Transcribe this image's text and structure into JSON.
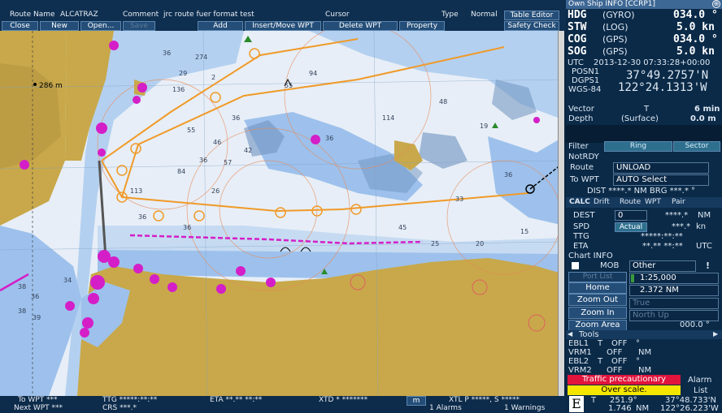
{
  "topbar": {
    "route_name_label": "Route Name",
    "route_name_value": "ALCATRAZ",
    "comment_label": "Comment",
    "comment_value": "jrc route fuer format test",
    "cursor_label": "Cursor",
    "type_label": "Type",
    "type_value": "Normal",
    "table_editor_label": "Table Editor",
    "close_label": "Close",
    "new_label": "New",
    "open_label": "Open...",
    "save_label": "Save",
    "add_label": "Add",
    "insert_move_label": "Insert/Move WPT",
    "delete_label": "Delete WPT",
    "property_label": "Property",
    "safety_check_label": "Safety Check"
  },
  "bottombar": {
    "to_wpt": "To WPT ***",
    "next_wpt": "Next WPT ***",
    "ttg": "TTG *****:**:**",
    "crs": "CRS ***.*",
    "eta": "ETA **.** **:**",
    "xtd": "XTD * *******",
    "xtd_unit": "m",
    "xtl": "XTL P *****, S *****",
    "alarms": "1 Alarms",
    "warnings": "1 Warnings"
  },
  "own_ship": {
    "title": "Own Ship INFO [CCRP1]",
    "hdg_label": "HDG",
    "hdg_src": "(GYRO)",
    "hdg_val": "034.0 °",
    "stw_label": "STW",
    "stw_src": "(LOG)",
    "stw_val": "5.0 kn",
    "cog_label": "COG",
    "cog_src": "(GPS)",
    "cog_val": "034.0 °",
    "sog_label": "SOG",
    "sog_src": "(GPS)",
    "sog_val": "5.0 kn",
    "utc_label": "UTC",
    "utc_val": "2013-12-30 07:33:28+00:00",
    "posn_label": "POSN1",
    "dgps_label": "DGPS1",
    "wgs_label": "WGS-84",
    "lat": "37°49.2757'N",
    "lon": "122°24.1313'W",
    "vector_label": "Vector",
    "vector_t": "T",
    "vector_val": "6 min",
    "depth_label": "Depth",
    "depth_src": "(Surface)",
    "depth_val": "0.0 m"
  },
  "filter": {
    "label": "Filter",
    "ring": "Ring",
    "sector": "Sector",
    "notrdy": "NotRDY"
  },
  "route": {
    "route_label": "Route",
    "route_val": "UNLOAD",
    "to_wpt_label": "To WPT",
    "to_wpt_val": "AUTO Select",
    "dist_brg": "DIST ****.* NM   BRG ***.* °"
  },
  "calc": {
    "tabs": [
      "CALC",
      "Drift",
      "Route",
      "WPT",
      "Pair"
    ],
    "dest_label": "DEST",
    "dest_val": "0",
    "dest_nm": "****.*",
    "dest_unit": "NM",
    "spd_label": "SPD",
    "spd_mode": "Actual",
    "spd_val": "***.*",
    "spd_unit": "kn",
    "ttg_label": "TTG",
    "ttg_val": "*****:**:**",
    "eta_label": "ETA",
    "eta_val": "**.** **:**",
    "eta_unit": "UTC"
  },
  "chart_info": {
    "title": "Chart INFO",
    "mob": "MOB",
    "other": "Other",
    "excl": "!",
    "port_list": "Port List",
    "scale": "1:25,000",
    "home": "Home",
    "range": "2.372 NM",
    "zoom_out": "Zoom Out",
    "true_label": "True",
    "zoom_in": "Zoom In",
    "north_up": "North Up",
    "zoom_area": "Zoom Area",
    "rot_val": "000.0 °"
  },
  "tools": {
    "title": "Tools",
    "ebl1": "EBL1",
    "ebl1_t": "T",
    "ebl1_state": "OFF",
    "ebl1_unit": "°",
    "vrm1": "VRM1",
    "vrm1_state": "OFF",
    "vrm1_unit": "NM",
    "ebl2": "EBL2",
    "ebl2_t": "T",
    "ebl2_state": "OFF",
    "ebl2_unit": "°",
    "vrm2": "VRM2",
    "vrm2_state": "OFF",
    "vrm2_unit": "NM"
  },
  "alerts": {
    "traffic": "Traffic precautionary",
    "overscale": "Over scale.",
    "alarm": "Alarm",
    "list": "List"
  },
  "cursor_readout": {
    "e": "E",
    "t": "T",
    "brg": "251.9°",
    "dist": "1.746",
    "dist_unit": "NM",
    "lat": "37°48.733'N",
    "lon": "122°26.223'W"
  },
  "chart_labels": {
    "depth_286": "286 m"
  },
  "colors": {
    "land": "#c8a84a",
    "shallow": "#9dc1ec",
    "deep": "#e7eef7",
    "route": "#f09a28",
    "magenta": "#d41fc8",
    "alert_red": "#e0143c",
    "alert_yellow": "#f5e600"
  }
}
